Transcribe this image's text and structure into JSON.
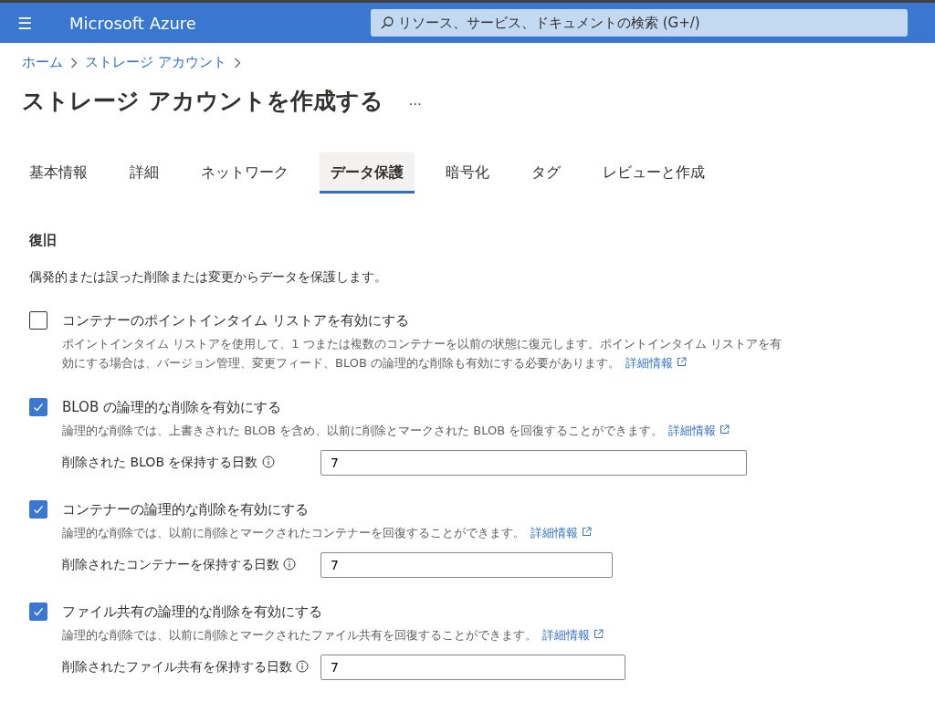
{
  "header": {
    "menu_icon": "☰",
    "brand": "Microsoft Azure",
    "search": {
      "placeholder": "リソース、サービス、ドキュメントの検索 (G+/)"
    }
  },
  "breadcrumb": [
    "ホーム",
    "ストレージ アカウント"
  ],
  "page": {
    "title": "ストレージ アカウントを作成する",
    "more": "…"
  },
  "tabs": [
    {
      "label": "基本情報",
      "selected": false
    },
    {
      "label": "詳細",
      "selected": false
    },
    {
      "label": "ネットワーク",
      "selected": false
    },
    {
      "label": "データ保護",
      "selected": true
    },
    {
      "label": "暗号化",
      "selected": false
    },
    {
      "label": "タグ",
      "selected": false
    },
    {
      "label": "レビューと作成",
      "selected": false
    }
  ],
  "section": {
    "heading": "復旧",
    "description": "偶発的または誤った削除または変更からデータを保護します。"
  },
  "options": [
    {
      "label": "コンテナーのポイントインタイム リストアを有効にする",
      "checked": false,
      "description": "ポイントインタイム リストアを使用して、1 つまたは複数のコンテナーを以前の状態に復元します。ポイントインタイム リストアを有効にする場合は、バージョン管理、変更フィード、BLOB の論理的な削除も有効にする必要があります。",
      "link": "詳細情報"
    },
    {
      "label": "BLOB の論理的な削除を有効にする",
      "checked": true,
      "description": "論理的な削除では、上書きされた BLOB を含め、以前に削除とマークされた BLOB を回復することができます。",
      "link": "詳細情報",
      "field": {
        "label": "削除された BLOB を保持する日数",
        "value": "7"
      }
    },
    {
      "label": "コンテナーの論理的な削除を有効にする",
      "checked": true,
      "description": "論理的な削除では、以前に削除とマークされたコンテナーを回復することができます。",
      "link": "詳細情報",
      "field": {
        "label": "削除されたコンテナーを保持する日数",
        "value": "7"
      }
    },
    {
      "label": "ファイル共有の論理的な削除を有効にする",
      "checked": true,
      "description": "論理的な削除では、以前に削除とマークされたファイル共有を回復することができます。",
      "link": "詳細情報",
      "field": {
        "label": "削除されたファイル共有を保持する日数",
        "value": "7"
      }
    }
  ]
}
